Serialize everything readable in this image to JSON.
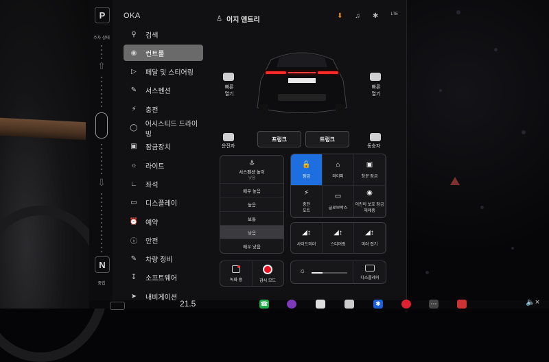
{
  "colors": {
    "accent": "#1d6fe0",
    "download": "#e48a2a",
    "active_menu": "#6a6a6a"
  },
  "gear": {
    "park": "P",
    "park_label": "주차 상태",
    "neutral": "N",
    "neutral_label": "중립"
  },
  "sidebar": {
    "profile_name": "OKA",
    "items": [
      {
        "label": "검색",
        "icon": "search-icon",
        "active": false
      },
      {
        "label": "컨트롤",
        "icon": "toggle-icon",
        "active": true
      },
      {
        "label": "페달 및 스티어링",
        "icon": "car-icon",
        "active": false
      },
      {
        "label": "서스펜션",
        "icon": "wrench-icon",
        "active": false
      },
      {
        "label": "충전",
        "icon": "bolt-icon",
        "active": false
      },
      {
        "label": "어시스티드 드라이빙",
        "icon": "wheel-icon",
        "active": false
      },
      {
        "label": "잠금장치",
        "icon": "lock-icon",
        "active": false
      },
      {
        "label": "라이트",
        "icon": "sun-icon",
        "active": false
      },
      {
        "label": "좌석",
        "icon": "seat-icon",
        "active": false
      },
      {
        "label": "디스플레이",
        "icon": "display-icon",
        "active": false
      },
      {
        "label": "예약",
        "icon": "alarm-icon",
        "active": false
      },
      {
        "label": "안전",
        "icon": "info-icon",
        "active": false
      },
      {
        "label": "차량 정비",
        "icon": "wrench-icon",
        "active": false
      },
      {
        "label": "소프트웨어",
        "icon": "download-icon",
        "active": false
      },
      {
        "label": "내비게이션",
        "icon": "nav-icon",
        "active": false
      }
    ]
  },
  "header": {
    "user": "이지 엔트리",
    "lte": "LTE"
  },
  "car": {
    "left_label_1": "빠른",
    "left_label_2": "열기",
    "right_label_1": "빠른",
    "right_label_2": "열기",
    "driver_label": "운전자",
    "passenger_label": "동승자",
    "frunk_label": "프렁크",
    "trunk_label": "트렁크"
  },
  "suspension": {
    "title": "서스펜션 높이",
    "current": "낮음",
    "options": [
      "매우 높음",
      "높음",
      "보통",
      "낮음",
      "매우 낮음"
    ],
    "selected_index": 3
  },
  "controls": [
    {
      "label": "잠금",
      "icon": "lock-icon",
      "highlight": true
    },
    {
      "label": "와이퍼",
      "icon": "wiper-icon",
      "highlight": false
    },
    {
      "label": "창문 잠금",
      "icon": "window-icon",
      "highlight": false
    },
    {
      "label": "충전\n포트",
      "icon": "bolt-icon",
      "highlight": false
    },
    {
      "label": "글로브박스",
      "icon": "glovebox-icon",
      "highlight": false
    },
    {
      "label": "어린이 보호 잠금\n해제중",
      "icon": "child-lock-icon",
      "highlight": false
    }
  ],
  "mirrors": [
    {
      "label": "사이드미러",
      "icon": "mirror-icon"
    },
    {
      "label": "스티어링",
      "icon": "steering-icon"
    },
    {
      "label": "미러 접기",
      "icon": "mirror-fold-icon"
    }
  ],
  "bottom_left": [
    {
      "label": "녹화 중",
      "icon": "camera-icon"
    },
    {
      "label": "감시 모드",
      "icon": "record-icon"
    }
  ],
  "brightness": {
    "display_label": "디스플레이",
    "level": 0.3
  },
  "dock": {
    "temp": "21.5"
  }
}
